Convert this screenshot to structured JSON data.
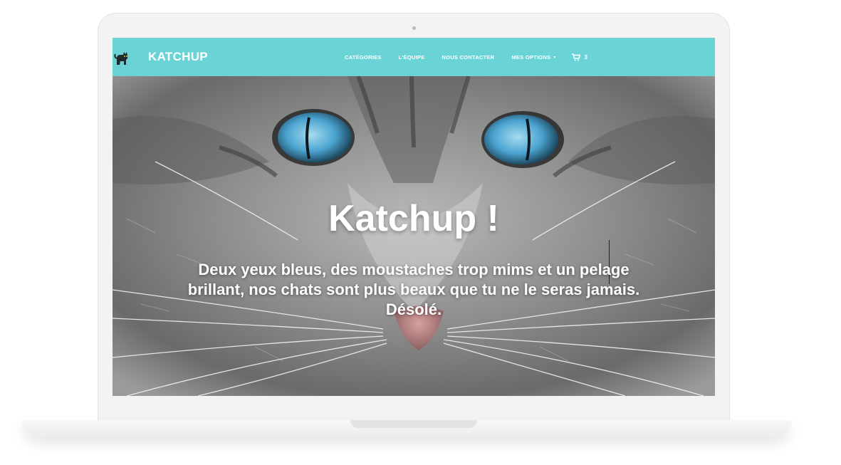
{
  "navbar": {
    "brand": "KATCHUP",
    "links": [
      "CATÉGORIES",
      "L'ÉQUIPE",
      "NOUS CONTACTER",
      "MES OPTIONS"
    ],
    "cart_count": "3",
    "color": "#6ad3d6"
  },
  "hero": {
    "title": "Katchup !",
    "subtitle": "Deux yeux bleus, des moustaches trop mims et un pelage brillant, nos chats sont plus beaux que tu ne le seras jamais. Désolé."
  },
  "icons": [
    "cat-logo-icon",
    "cart-icon",
    "caret-down-icon"
  ]
}
